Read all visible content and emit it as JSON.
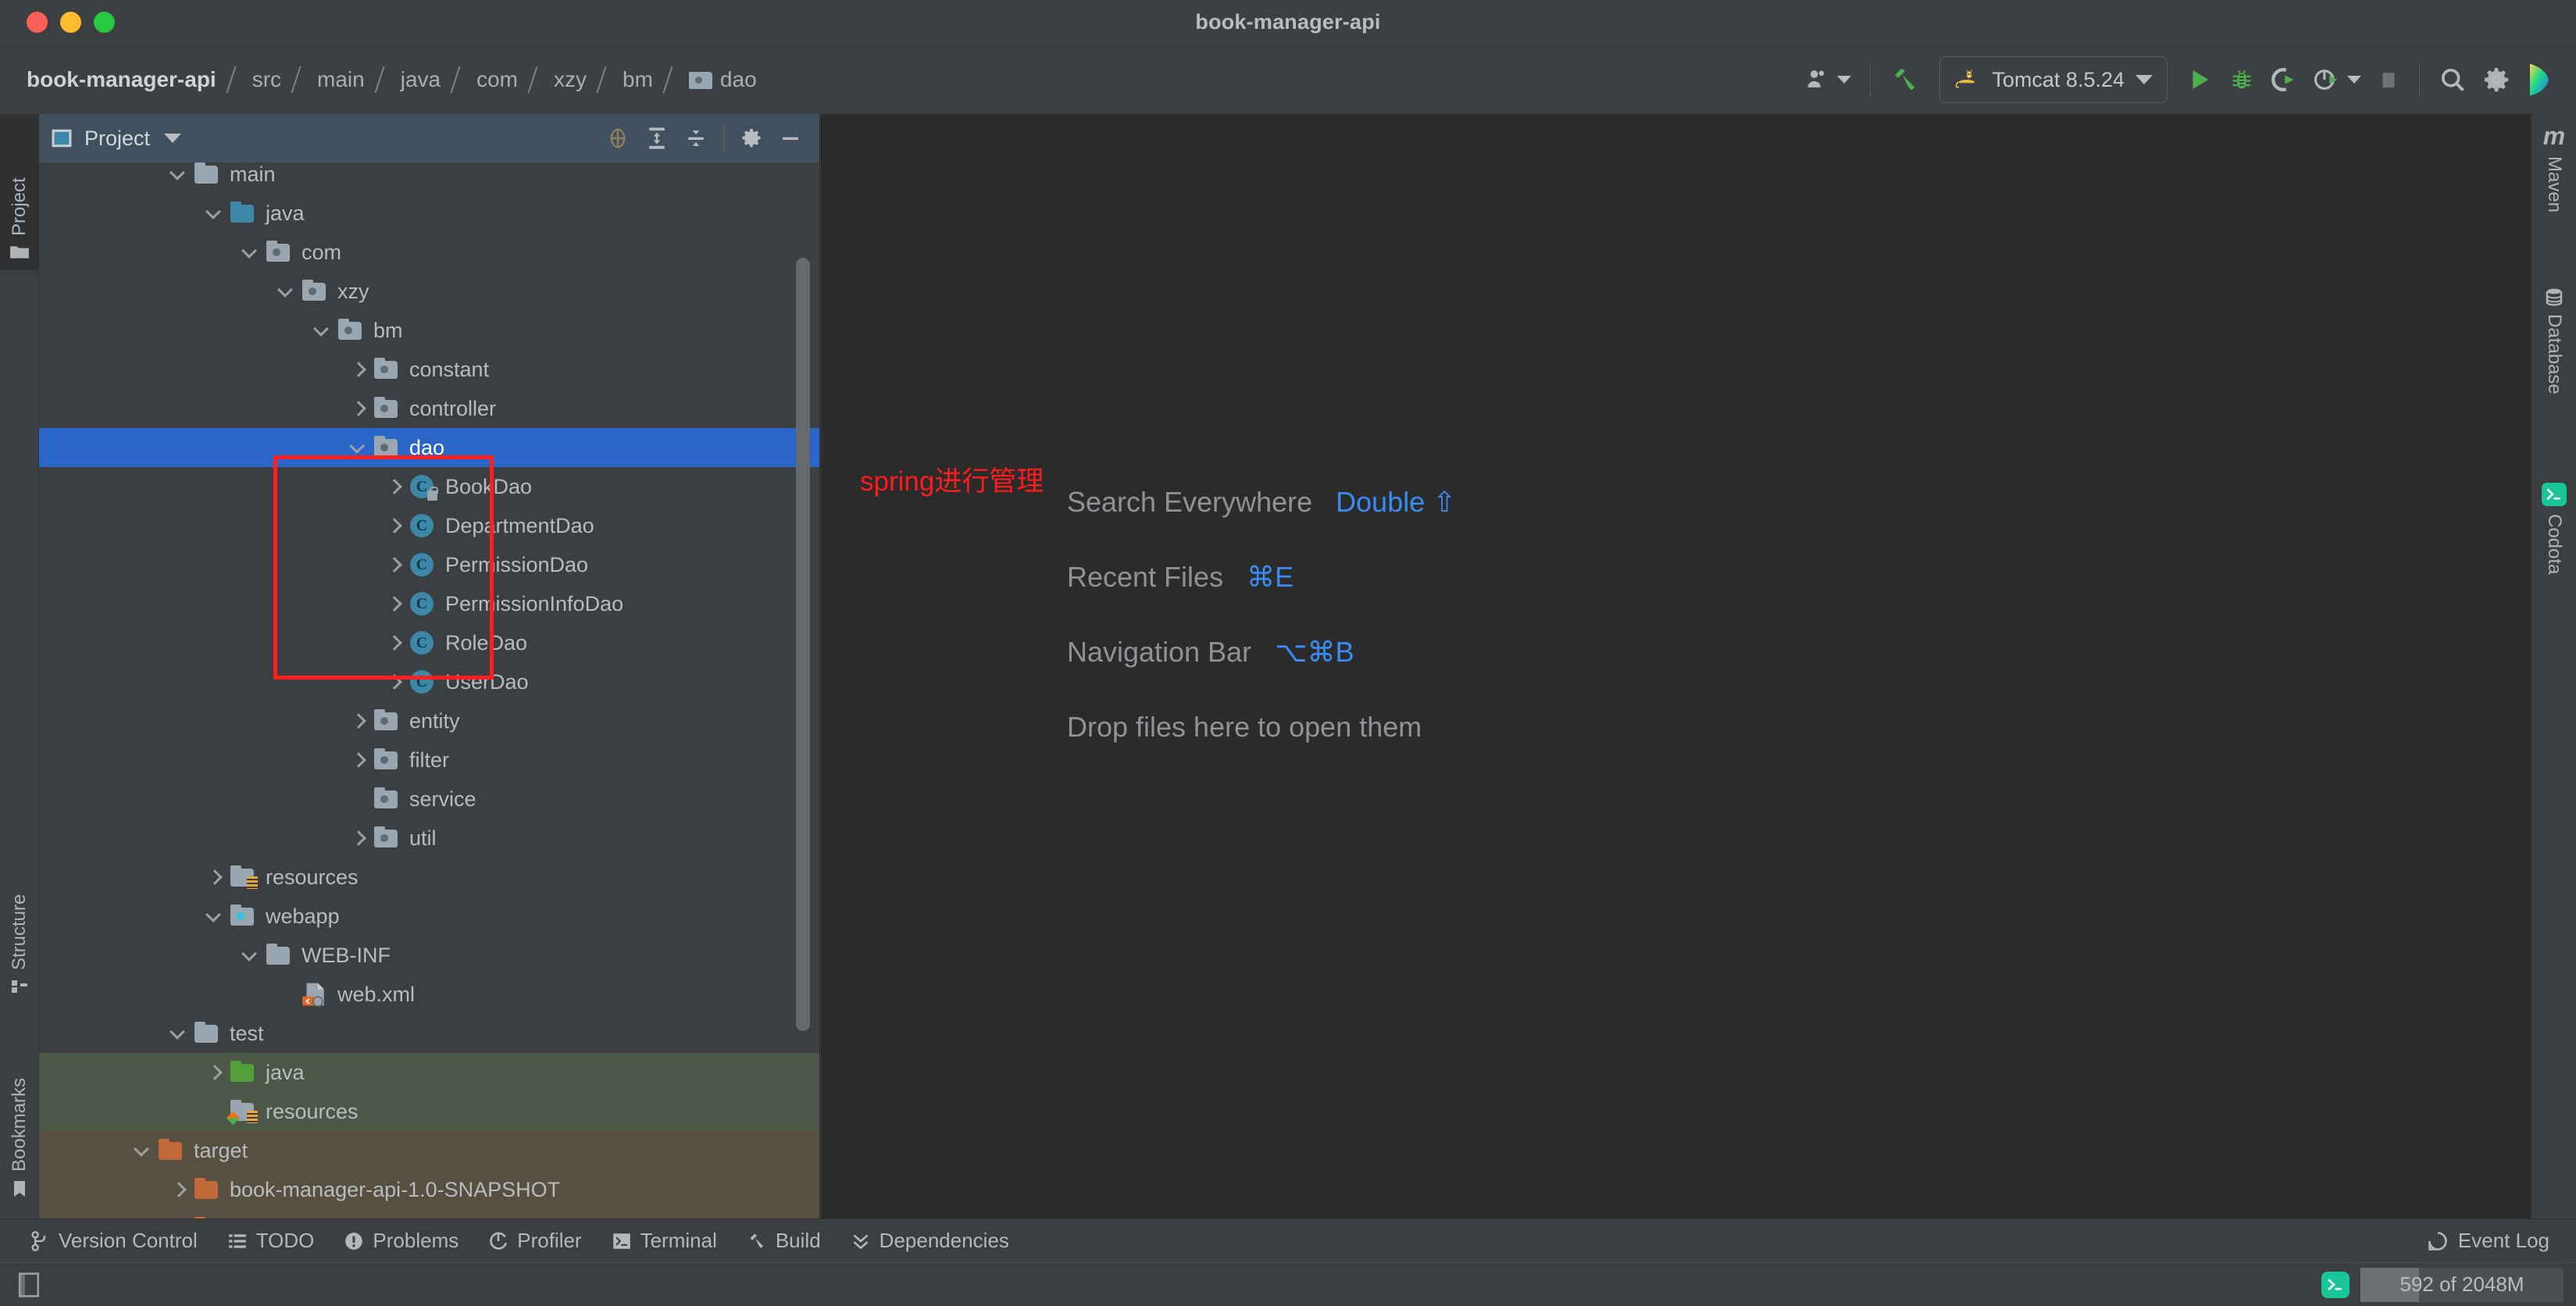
{
  "window": {
    "title": "book-manager-api",
    "traffic_lights": [
      "close-red",
      "minimize-yellow",
      "zoom-green"
    ]
  },
  "navbar": {
    "breadcrumbs": [
      {
        "label": "book-manager-api",
        "icon": null
      },
      {
        "label": "src",
        "icon": null
      },
      {
        "label": "main",
        "icon": null
      },
      {
        "label": "java",
        "icon": null
      },
      {
        "label": "com",
        "icon": null
      },
      {
        "label": "xzy",
        "icon": null
      },
      {
        "label": "bm",
        "icon": null
      },
      {
        "label": "dao",
        "icon": "package-folder-icon"
      }
    ],
    "toolbar": {
      "profile_icon": "user-profile-icon",
      "build_icon": "hammer-build-icon",
      "run_config": {
        "icon": "tomcat-cat-icon",
        "label": "Tomcat 8.5.24",
        "dropdown": "chevron-down-icon"
      },
      "run_label": "Run",
      "debug_label": "Debug",
      "run_coverage_label": "Run with Coverage",
      "profile_run_label": "Profile",
      "stop_label": "Stop",
      "search_label": "Search",
      "settings_label": "Settings",
      "ide_badge": "jetbrains-logo-icon"
    }
  },
  "rails": {
    "left": [
      {
        "label": "Project",
        "icon": "project-folder-icon",
        "active": true
      },
      {
        "label": "Structure",
        "icon": "structure-icon",
        "active": false
      },
      {
        "label": "Bookmarks",
        "icon": "bookmark-icon",
        "active": false
      }
    ],
    "right": [
      {
        "label": "Maven",
        "icon": "maven-m-icon",
        "active": false
      },
      {
        "label": "Database",
        "icon": "database-icon",
        "active": false
      },
      {
        "label": "Codota",
        "icon": "codota-icon",
        "active": false
      }
    ]
  },
  "project_panel": {
    "title": "Project",
    "title_dropdown": "chevron-down-icon",
    "header_icons": [
      "scroll-from-source-icon",
      "expand-all-icon",
      "collapse-all-icon",
      "gear-icon",
      "hide-icon"
    ],
    "tree": [
      {
        "label": "main",
        "indent": 2,
        "arrow": "down",
        "icon": "folder-gray",
        "clipped": true
      },
      {
        "label": "java",
        "indent": 3,
        "arrow": "down",
        "icon": "folder-blue"
      },
      {
        "label": "com",
        "indent": 4,
        "arrow": "down",
        "icon": "folder-package"
      },
      {
        "label": "xzy",
        "indent": 5,
        "arrow": "down",
        "icon": "folder-package"
      },
      {
        "label": "bm",
        "indent": 6,
        "arrow": "down",
        "icon": "folder-package"
      },
      {
        "label": "constant",
        "indent": 7,
        "arrow": "right",
        "icon": "folder-package"
      },
      {
        "label": "controller",
        "indent": 7,
        "arrow": "right",
        "icon": "folder-package"
      },
      {
        "label": "dao",
        "indent": 7,
        "arrow": "down",
        "icon": "folder-package",
        "selected": true
      },
      {
        "label": "BookDao",
        "indent": 8,
        "arrow": "right",
        "icon": "class-icon-locked"
      },
      {
        "label": "DepartmentDao",
        "indent": 8,
        "arrow": "right",
        "icon": "class-icon"
      },
      {
        "label": "PermissionDao",
        "indent": 8,
        "arrow": "right",
        "icon": "class-icon"
      },
      {
        "label": "PermissionInfoDao",
        "indent": 8,
        "arrow": "right",
        "icon": "class-icon"
      },
      {
        "label": "RoleDao",
        "indent": 8,
        "arrow": "right",
        "icon": "class-icon"
      },
      {
        "label": "UserDao",
        "indent": 8,
        "arrow": "right",
        "icon": "class-icon"
      },
      {
        "label": "entity",
        "indent": 7,
        "arrow": "right",
        "icon": "folder-package"
      },
      {
        "label": "filter",
        "indent": 7,
        "arrow": "right",
        "icon": "folder-package"
      },
      {
        "label": "service",
        "indent": 7,
        "arrow": "none",
        "icon": "folder-package"
      },
      {
        "label": "util",
        "indent": 7,
        "arrow": "right",
        "icon": "folder-package"
      },
      {
        "label": "resources",
        "indent": 3,
        "arrow": "right",
        "icon": "folder-resources"
      },
      {
        "label": "webapp",
        "indent": 3,
        "arrow": "down",
        "icon": "folder-webapp"
      },
      {
        "label": "WEB-INF",
        "indent": 4,
        "arrow": "down",
        "icon": "folder-plain"
      },
      {
        "label": "web.xml",
        "indent": 5,
        "arrow": "none",
        "icon": "xml-file-icon"
      },
      {
        "label": "test",
        "indent": 2,
        "arrow": "down",
        "icon": "folder-plain"
      },
      {
        "label": "java",
        "indent": 3,
        "arrow": "right",
        "icon": "folder-green",
        "scope": "test"
      },
      {
        "label": "resources",
        "indent": 3,
        "arrow": "none",
        "icon": "folder-test-resources",
        "scope": "test"
      },
      {
        "label": "target",
        "indent": 1,
        "arrow": "down",
        "icon": "folder-orange",
        "scope": "target"
      },
      {
        "label": "book-manager-api-1.0-SNAPSHOT",
        "indent": 2,
        "arrow": "right",
        "icon": "folder-orange",
        "scope": "target"
      },
      {
        "label": "classes",
        "indent": 2,
        "arrow": "right",
        "icon": "folder-orange",
        "scope": "target",
        "clipped": true
      }
    ]
  },
  "annotation": {
    "red_text": "spring进行管理",
    "red_box_target": "dao-class-list"
  },
  "editor": {
    "hints": [
      {
        "action": "Search Everywhere",
        "shortcut": "Double ⇧"
      },
      {
        "action": "Recent Files",
        "shortcut": "⌘E"
      },
      {
        "action": "Navigation Bar",
        "shortcut": "⌥⌘B"
      },
      {
        "action": "Drop files here to open them",
        "shortcut": ""
      }
    ]
  },
  "bottom_bar": {
    "items": [
      {
        "label": "Version Control",
        "icon": "branch-icon"
      },
      {
        "label": "TODO",
        "icon": "todo-list-icon"
      },
      {
        "label": "Problems",
        "icon": "problems-icon"
      },
      {
        "label": "Profiler",
        "icon": "profiler-icon"
      },
      {
        "label": "Terminal",
        "icon": "terminal-icon"
      },
      {
        "label": "Build",
        "icon": "hammer-build-icon"
      },
      {
        "label": "Dependencies",
        "icon": "dependencies-icon"
      }
    ],
    "event_log": {
      "label": "Event Log",
      "icon": "event-log-icon"
    }
  },
  "status_bar": {
    "layout_icon": "toggle-toolwindows-icon",
    "codota_icon": "codota-icon",
    "memory": "592 of 2048M",
    "memory_used_pct": 29
  },
  "colors": {
    "selection_blue": "#2a65c8",
    "annotation_red": "#fd1c1c",
    "shortcut_blue": "#3a8bf2",
    "panel_bg": "#3c3f41",
    "editor_bg": "#2b2b2b",
    "header_bg": "#41505f",
    "test_scope": "#4b5847",
    "target_scope": "#574f3f",
    "codota_green": "#18c69a"
  }
}
